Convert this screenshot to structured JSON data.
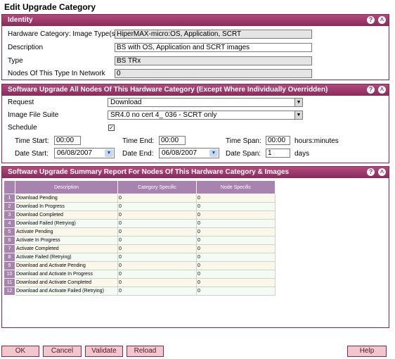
{
  "page": {
    "title": "Edit Upgrade Category"
  },
  "identity": {
    "header": "Identity",
    "fields": [
      {
        "label": "Hardware Category: Image Type(s)",
        "value": "HiperMAX-micro:OS, Application, SCRT"
      },
      {
        "label": "Description",
        "value": "BS with OS, Application and SCRT images"
      },
      {
        "label": "Type",
        "value": "BS TRx"
      },
      {
        "label": "Nodes Of This Type In Network",
        "value": "0"
      }
    ]
  },
  "upgrade": {
    "header": "Software Upgrade All Nodes Of This Hardware Category (Except Where Individually Overridden)",
    "request": {
      "label": "Request",
      "value": "Download"
    },
    "suite": {
      "label": "Image File Suite",
      "value": "SR4.0 no cert 4_ 036 - SCRT only"
    },
    "schedule": {
      "label": "Schedule",
      "checked": "✓"
    },
    "time_start": {
      "label": "Time Start:",
      "value": "00:00"
    },
    "time_end": {
      "label": "Time End:",
      "value": "00:00"
    },
    "time_span": {
      "label": "Time Span:",
      "value": "00:00",
      "unit": "hours:minutes"
    },
    "date_start": {
      "label": "Date Start:",
      "value": "06/08/2007"
    },
    "date_end": {
      "label": "Date End:",
      "value": "06/08/2007"
    },
    "date_span": {
      "label": "Date Span:",
      "value": "1",
      "unit": "days"
    }
  },
  "summary": {
    "header": "Software Upgrade Summary Report For Nodes Of This Hardware Category & Images",
    "columns": [
      "Description",
      "Category Specific",
      "Node Specific"
    ],
    "rows": [
      {
        "n": "1",
        "desc": "Download Pending",
        "cat": "0",
        "node": "0"
      },
      {
        "n": "2",
        "desc": "Download In Progress",
        "cat": "0",
        "node": "0"
      },
      {
        "n": "3",
        "desc": "Download Completed",
        "cat": "0",
        "node": "0"
      },
      {
        "n": "4",
        "desc": "Download Failed (Retrying)",
        "cat": "0",
        "node": "0"
      },
      {
        "n": "5",
        "desc": "Activate Pending",
        "cat": "0",
        "node": "0"
      },
      {
        "n": "6",
        "desc": "Activate In Progress",
        "cat": "0",
        "node": "0"
      },
      {
        "n": "7",
        "desc": "Activate Completed",
        "cat": "0",
        "node": "0"
      },
      {
        "n": "8",
        "desc": "Activate Failed (Retrying)",
        "cat": "0",
        "node": "0"
      },
      {
        "n": "9",
        "desc": "Download and Activate Pending",
        "cat": "0",
        "node": "0"
      },
      {
        "n": "10",
        "desc": "Download and Activate In Progress",
        "cat": "0",
        "node": "0"
      },
      {
        "n": "11",
        "desc": "Download and Activate Completed",
        "cat": "0",
        "node": "0"
      },
      {
        "n": "12",
        "desc": "Download and Activate Failed (Retrying)",
        "cat": "0",
        "node": "0"
      }
    ]
  },
  "header_icons": {
    "help": "?",
    "collapse": "˄"
  },
  "buttons": {
    "ok": "OK",
    "cancel": "Cancel",
    "validate": "Validate",
    "reload": "Reload",
    "help": "Help"
  },
  "icons": {
    "dropdown_arrow": "▼",
    "calendar_arrow": "▼"
  },
  "colors": {
    "panel_header": "#8a2a5a",
    "table_header": "#a883b0",
    "button_bg": "#f0c8cc"
  }
}
